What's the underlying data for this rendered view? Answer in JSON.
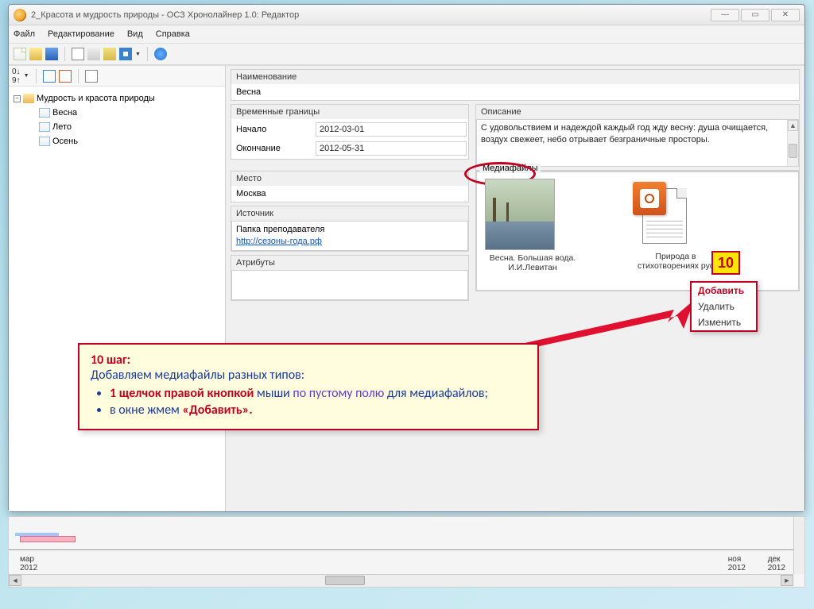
{
  "titlebar": {
    "title": "2_Красота и мудрость природы - ОСЗ Хронолайнер 1.0: Редактор"
  },
  "menu": {
    "file": "Файл",
    "edit": "Редактирование",
    "view": "Вид",
    "help": "Справка"
  },
  "tree": {
    "root": "Мудрость и красота природы",
    "children": [
      "Весна",
      "Лето",
      "Осень"
    ]
  },
  "form": {
    "name_label": "Наименование",
    "name_value": "Весна",
    "timerange_label": "Временные границы",
    "start_label": "Начало",
    "start_value": "2012-03-01",
    "end_label": "Окончание",
    "end_value": "2012-05-31",
    "place_label": "Место",
    "place_value": "Москва",
    "source_label": "Источник",
    "source_text": "Папка преподавателя",
    "source_link": "http://сезоны-года.рф",
    "attr_label": "Атрибуты",
    "desc_label": "Описание",
    "desc_value": "С удовольствием и надеждой каждый год жду весну: душа очищается, воздух свежеет, небо отрывает безграничные просторы.",
    "media_label": "Медиафайлы",
    "media1_caption": "Весна. Большая вода. И.И.Левитан",
    "media2_caption": "Природа в стихотворениях рус"
  },
  "context": {
    "badge": "10",
    "items": [
      "Добавить",
      "Удалить",
      "Изменить"
    ]
  },
  "timeline": {
    "m1": "мар",
    "y1": "2012",
    "m2": "ноя",
    "y2": "2012",
    "m3": "дек",
    "y3": "2012"
  },
  "instruction": {
    "title": "10 шаг:",
    "line1": "Добавляем медиафайлы разных типов:",
    "bullet1a": "1 щелчок правой кнопкой",
    "bullet1b": " мыши ",
    "bullet1c": "по пустому полю",
    "bullet1d": " для медиафайлов;",
    "bullet2a": "в окне жмем ",
    "bullet2b": "«Добавить»."
  }
}
